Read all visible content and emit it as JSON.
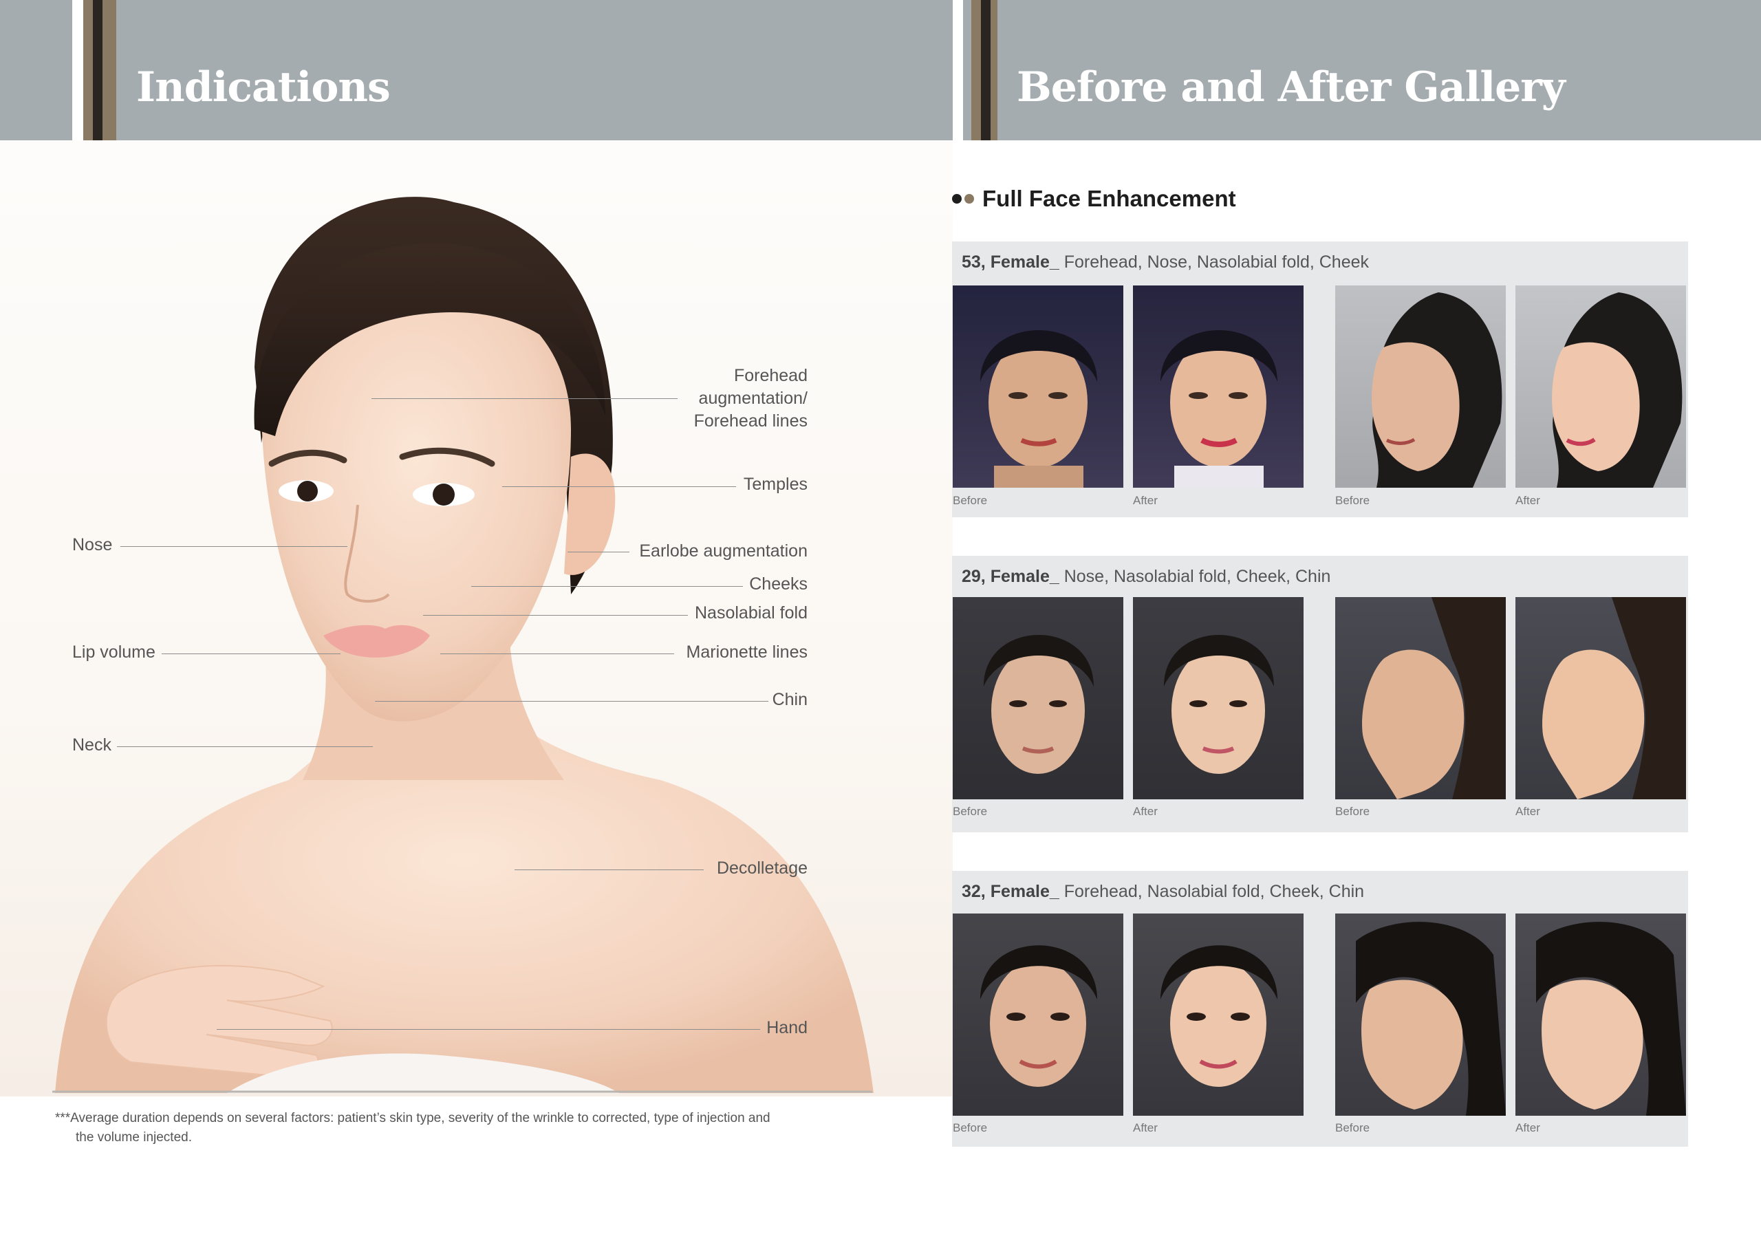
{
  "header": {
    "left_title": "Indications",
    "right_title": "Before and After Gallery"
  },
  "indications": {
    "right_labels": {
      "forehead_1": "Forehead",
      "forehead_2": "augmentation/",
      "forehead_3": "Forehead lines",
      "temples": "Temples",
      "earlobe": "Earlobe augmentation",
      "cheeks": "Cheeks",
      "nasolabial": "Nasolabial fold",
      "marionette": "Marionette lines",
      "chin": "Chin",
      "decolletage": "Decolletage",
      "hand": "Hand"
    },
    "left_labels": {
      "nose": "Nose",
      "lip": "Lip volume",
      "neck": "Neck"
    },
    "footnote_1": "***Average duration depends on several factors: patient’s skin type, severity of the wrinkle to corrected, type of injection and",
    "footnote_2": "the volume injected."
  },
  "gallery": {
    "section_title": "Full Face Enhancement",
    "cases": [
      {
        "bold": "53, Female_",
        "areas": " Forehead, Nose, Nasolabial fold, Cheek",
        "labels": [
          "Before",
          "After",
          "Before",
          "After"
        ]
      },
      {
        "bold": "29, Female_",
        "areas": " Nose, Nasolabial fold, Cheek, Chin",
        "labels": [
          "Before",
          "After",
          "Before",
          "After"
        ]
      },
      {
        "bold": "32, Female_",
        "areas": " Forehead, Nasolabial fold, Cheek, Chin",
        "labels": [
          "Before",
          "After",
          "Before",
          "After"
        ]
      }
    ]
  },
  "colors": {
    "header_gray": "#a5acb0",
    "accent_dark": "#2b2522",
    "accent_gold": "#8a7a63",
    "case_bg": "#e6e8ea"
  }
}
